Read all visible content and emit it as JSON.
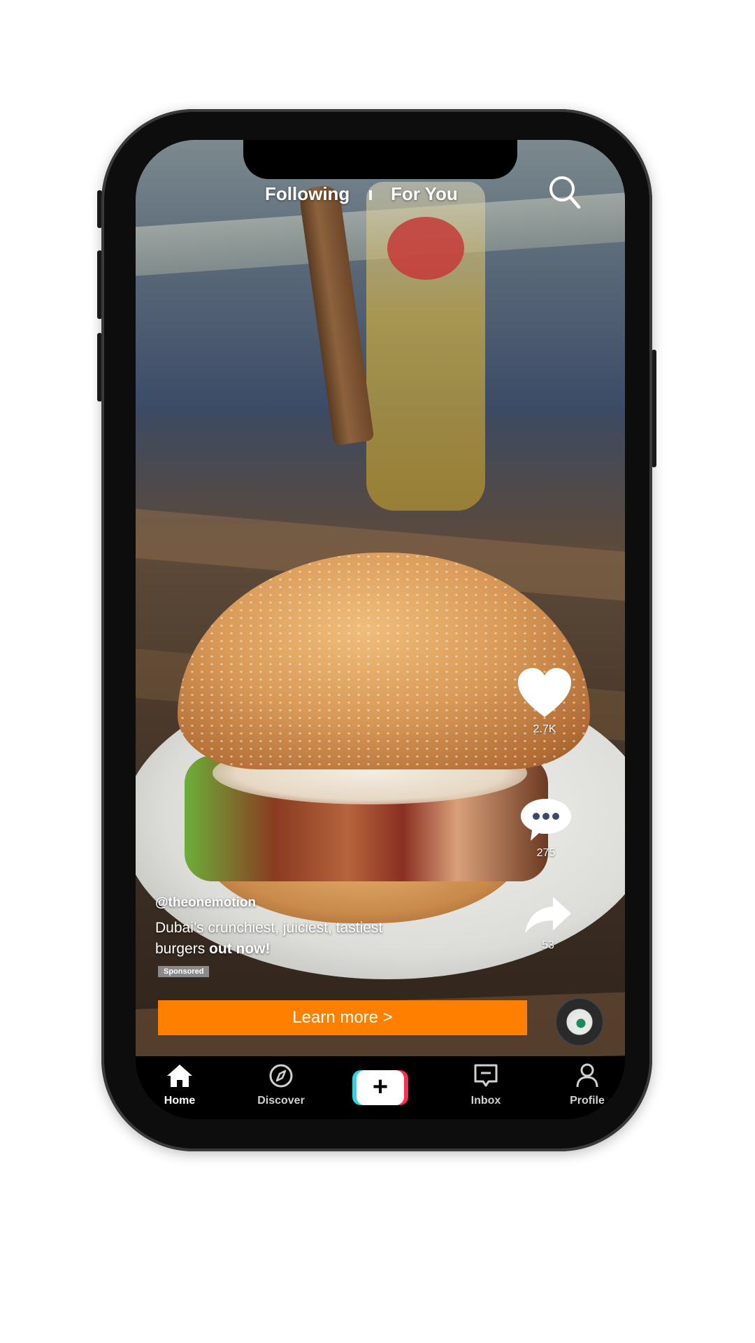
{
  "header": {
    "tabs": [
      {
        "label": "Following"
      },
      {
        "label": "For You"
      }
    ],
    "search_icon": "search-icon"
  },
  "actions": {
    "like": {
      "icon": "heart-icon",
      "count": "2.7K"
    },
    "comment": {
      "icon": "comment-icon",
      "count": "275"
    },
    "share": {
      "icon": "share-icon",
      "count": "53"
    }
  },
  "post": {
    "username": "@theonemotion",
    "description_line1": "Dubai’s crunchiest, juiciest, tastiest",
    "description_line2_prefix": "burgers ",
    "description_line2_bold": "out now!",
    "sponsored_label": "Sponsored",
    "cta_label": "Learn more  >"
  },
  "nav": {
    "items": [
      {
        "label": "Home",
        "icon": "home-icon"
      },
      {
        "label": "Discover",
        "icon": "compass-icon"
      },
      {
        "label": "",
        "icon": "plus-icon"
      },
      {
        "label": "Inbox",
        "icon": "inbox-icon"
      },
      {
        "label": "Profile",
        "icon": "profile-icon"
      }
    ]
  },
  "colors": {
    "cta": "#ff7f00",
    "add_left": "#2fd3e1",
    "add_right": "#ff2d55"
  }
}
